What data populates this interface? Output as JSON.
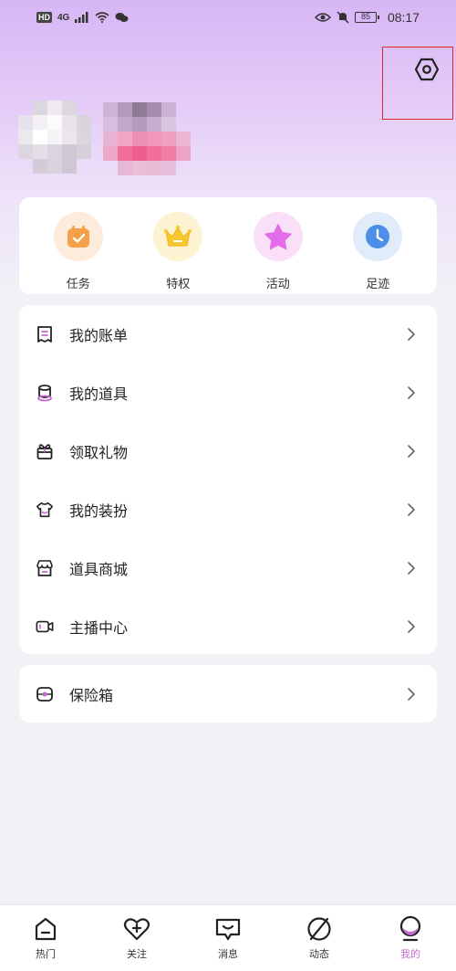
{
  "status_bar": {
    "hd": "HD",
    "network": "4G",
    "battery": "85",
    "time": "08:17"
  },
  "quick_actions": [
    {
      "label": "任务",
      "icon": "task-calendar-icon"
    },
    {
      "label": "特权",
      "icon": "crown-icon"
    },
    {
      "label": "活动",
      "icon": "star-icon"
    },
    {
      "label": "足迹",
      "icon": "clock-icon"
    }
  ],
  "menu": [
    {
      "label": "我的账单",
      "icon": "bill-icon"
    },
    {
      "label": "我的道具",
      "icon": "props-icon"
    },
    {
      "label": "领取礼物",
      "icon": "gift-icon"
    },
    {
      "label": "我的装扮",
      "icon": "outfit-icon"
    },
    {
      "label": "道具商城",
      "icon": "store-icon"
    },
    {
      "label": "主播中心",
      "icon": "camera-icon"
    }
  ],
  "safe_box": {
    "label": "保险箱",
    "icon": "safe-icon"
  },
  "bottom_nav": [
    {
      "label": "热门",
      "icon": "home-icon"
    },
    {
      "label": "关注",
      "icon": "heart-plus-icon"
    },
    {
      "label": "消息",
      "icon": "message-icon"
    },
    {
      "label": "动态",
      "icon": "moments-icon"
    },
    {
      "label": "我的",
      "icon": "profile-icon",
      "active": true
    }
  ],
  "colors": {
    "accent": "#c66ad1",
    "task": "#f4a14a",
    "crown": "#f7c72e",
    "star": "#e46ce8",
    "clock": "#4c8ee8"
  }
}
